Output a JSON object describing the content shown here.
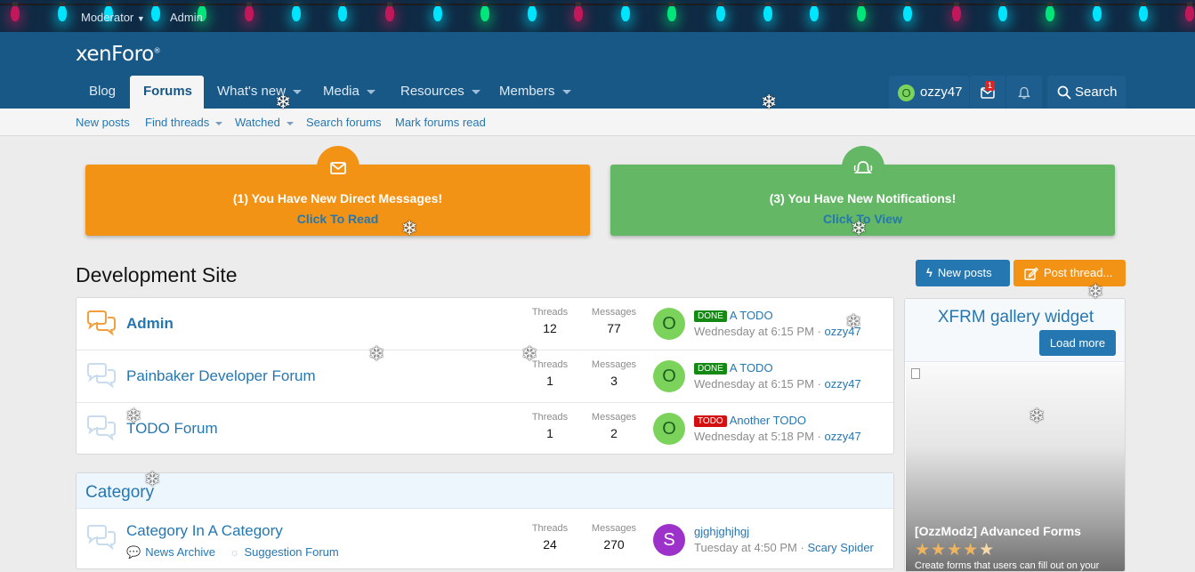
{
  "staff_bar": {
    "moderator_label": "Moderator",
    "admin_label": "Admin"
  },
  "header": {
    "logo": "xenForo",
    "logo_mark": "®",
    "nav": [
      {
        "label": "Blog"
      },
      {
        "label": "Forums"
      },
      {
        "label": "What's new"
      },
      {
        "label": "Media"
      },
      {
        "label": "Resources"
      },
      {
        "label": "Members"
      }
    ],
    "user": {
      "avatar_letter": "O",
      "name": "ozzy47"
    },
    "conversations_badge": "1",
    "search_label": "Search"
  },
  "subnav": {
    "items": [
      {
        "label": "New posts"
      },
      {
        "label": "Find threads"
      },
      {
        "label": "Watched"
      },
      {
        "label": "Search forums"
      },
      {
        "label": "Mark forums read"
      }
    ]
  },
  "notices": [
    {
      "message": "(1)  You Have New Direct Messages!",
      "cta": "Click To Read",
      "icon": "envelope-icon"
    },
    {
      "message": "(3)  You Have New Notifications!",
      "cta": "Click To View",
      "icon": "bell-icon"
    }
  ],
  "page": {
    "title": "Development Site",
    "new_posts_label": "New posts",
    "post_thread_label": "Post thread..."
  },
  "stat_labels": {
    "threads": "Threads",
    "messages": "Messages"
  },
  "forums": [
    {
      "title": "Admin",
      "threads": "12",
      "messages": "77",
      "avatar": "O",
      "prefix": "DONE",
      "last_title": "A TODO",
      "last_time": "Wednesday at 6:15 PM",
      "last_user": "ozzy47"
    },
    {
      "title": "Painbaker Developer Forum",
      "threads": "1",
      "messages": "3",
      "avatar": "O",
      "prefix": "DONE",
      "last_title": "A TODO",
      "last_time": "Wednesday at 6:15 PM",
      "last_user": "ozzy47"
    },
    {
      "title": "TODO Forum",
      "threads": "1",
      "messages": "2",
      "avatar": "O",
      "prefix": "TODO",
      "last_title": "Another TODO",
      "last_time": "Wednesday at 5:18 PM",
      "last_user": "ozzy47"
    }
  ],
  "category": {
    "title": "Category",
    "node": {
      "title": "Category In A Category",
      "subforums": [
        "News Archive",
        "Suggestion Forum"
      ],
      "threads": "24",
      "messages": "270",
      "avatar": "S",
      "last_title": "gjghjghjhgj",
      "last_time": "Tuesday at 4:50 PM",
      "separator": "·",
      "last_user": "Scary Spider"
    }
  },
  "widget": {
    "title": "XFRM gallery widget",
    "load_more": "Load more",
    "item_title": "[OzzModz] Advanced Forms",
    "rating": 4.5,
    "item_desc": "Create forms that users can fill out on your"
  },
  "colors": {
    "header": "#185886",
    "accent": "#2577b1",
    "orange": "#f39315",
    "green": "#63b765"
  }
}
